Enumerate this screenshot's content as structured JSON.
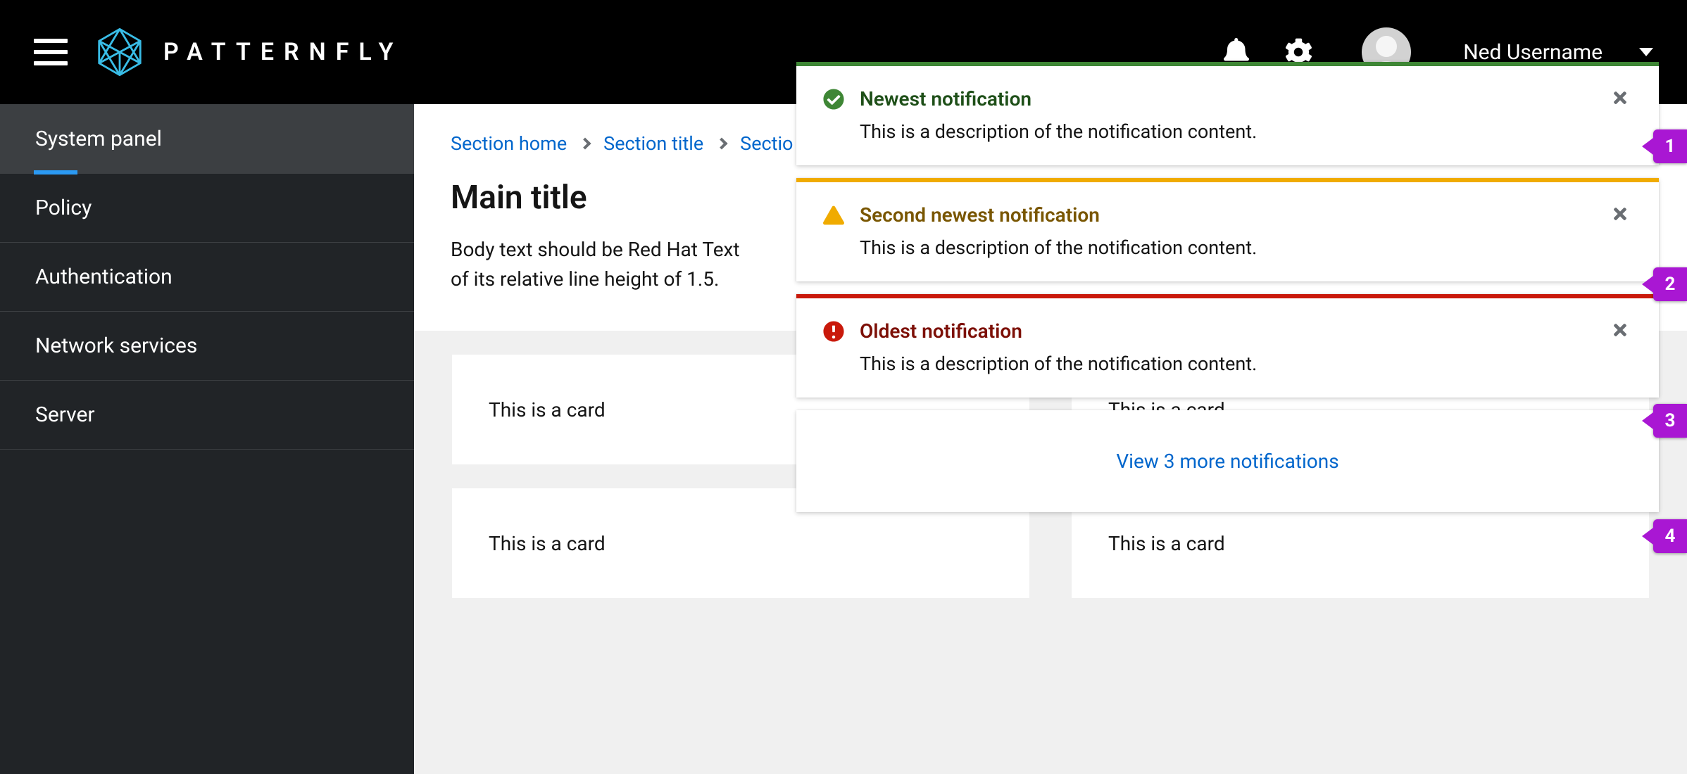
{
  "masthead": {
    "brand": "PATTERNFLY",
    "user_name": "Ned Username"
  },
  "sidebar": {
    "items": [
      {
        "label": "System panel",
        "active": true
      },
      {
        "label": "Policy"
      },
      {
        "label": "Authentication"
      },
      {
        "label": "Network services"
      },
      {
        "label": "Server"
      }
    ]
  },
  "breadcrumb": {
    "items": [
      {
        "label": "Section home"
      },
      {
        "label": "Section title"
      },
      {
        "label": "Sectio"
      }
    ]
  },
  "page": {
    "title": "Main title",
    "body_line1": "Body text should be Red Hat Text",
    "body_line2": "of its relative line height of 1.5."
  },
  "cards": [
    {
      "text": "This is a card"
    },
    {
      "text": "This is a card"
    },
    {
      "text": "This is a card"
    },
    {
      "text": "This is a card"
    }
  ],
  "alerts": [
    {
      "variant": "success",
      "title": "Newest notification",
      "description": "This is a description of the notification content."
    },
    {
      "variant": "warning",
      "title": "Second newest notification",
      "description": "This is a description of the notification content."
    },
    {
      "variant": "danger",
      "title": "Oldest notification",
      "description": "This is a description of the notification content."
    }
  ],
  "overflow_link": "View 3 more notifications",
  "callouts": [
    "1",
    "2",
    "3",
    "4"
  ]
}
